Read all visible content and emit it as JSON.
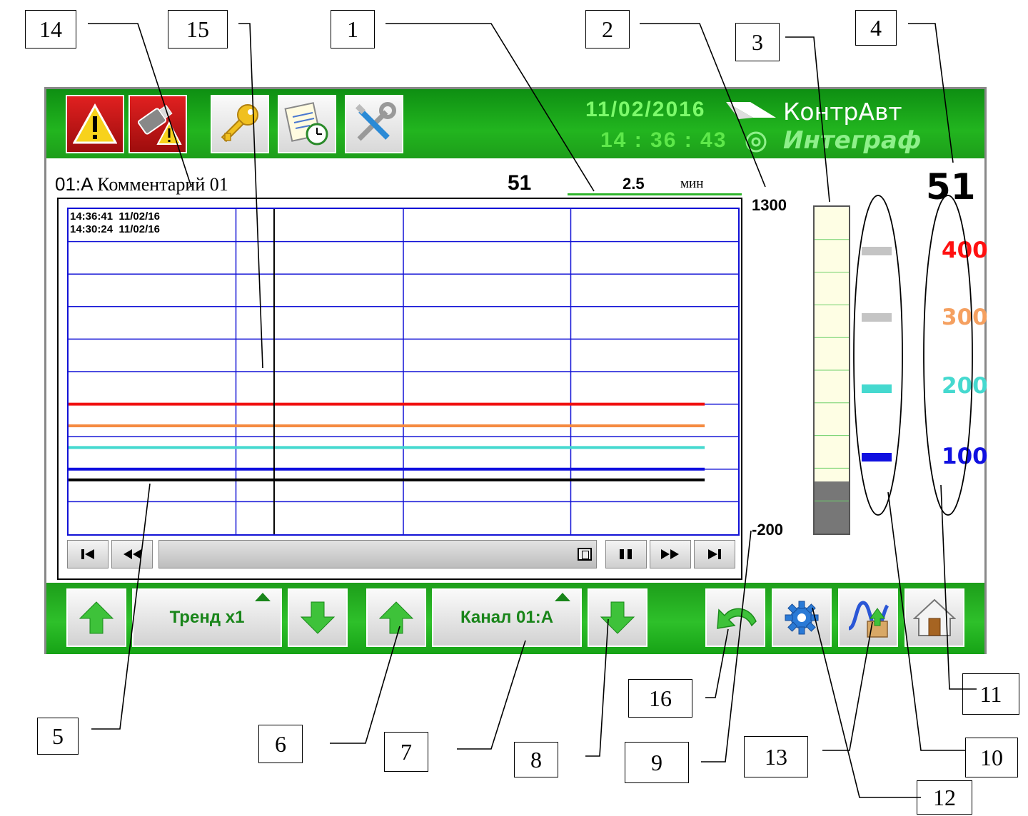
{
  "header": {
    "date": "11/02/2016",
    "time": "14 : 36 : 43",
    "brand_name": "КонтрАвт",
    "product_name": "Интеграф"
  },
  "channel": {
    "code": "01:A",
    "comment": "Комментарий 01",
    "value_small": "51",
    "value_big": "51",
    "time_span": "2.5",
    "time_unit": "мин"
  },
  "chart": {
    "timestamps": [
      "14:36:41  11/02/16",
      "14:30:24  11/02/16"
    ],
    "scale_max": "1300",
    "scale_min": "-200",
    "bar_level_percent": 16,
    "lines": [
      {
        "color": "#f01010",
        "value": 400
      },
      {
        "color": "#f58a40",
        "value": 300
      },
      {
        "color": "#45d9cf",
        "value": 200
      },
      {
        "color": "#1010e0",
        "value": 100
      },
      {
        "color": "#000000",
        "value": 51
      }
    ]
  },
  "limits": [
    {
      "label": "400",
      "color": "#ff1010",
      "marker": "#c4c4c4"
    },
    {
      "label": "300",
      "color": "#f5a060",
      "marker": "#c4c4c4"
    },
    {
      "label": "200",
      "color": "#45d9cf",
      "marker": "#45d9cf"
    },
    {
      "label": "100",
      "color": "#1010e0",
      "marker": "#1010e0"
    }
  ],
  "top_buttons": [
    "alarm-icon",
    "usb-alarm-icon",
    "key-icon",
    "schedule-icon",
    "tools-icon"
  ],
  "bottom_buttons": {
    "trend_label": "Тренд х1",
    "channel_label": "Канал 01:А"
  },
  "callouts": [
    "1",
    "2",
    "3",
    "4",
    "5",
    "6",
    "7",
    "8",
    "9",
    "10",
    "11",
    "12",
    "13",
    "14",
    "15",
    "16"
  ]
}
